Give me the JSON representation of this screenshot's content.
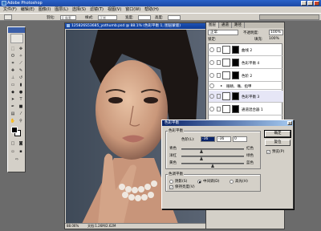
{
  "app": {
    "title": "Adobe Photoshop"
  },
  "menu": [
    "文件(F)",
    "编辑(E)",
    "图像(I)",
    "图层(L)",
    "选择(S)",
    "滤镜(T)",
    "视图(V)",
    "窗口(W)",
    "帮助(H)"
  ],
  "options": {
    "feather_label": "羽化:",
    "feather_value": "0 像素",
    "style_label": "样式:",
    "style_value": "正常",
    "width_label": "宽度:",
    "height_label": "高度:"
  },
  "document": {
    "title": "125826S53685_yothumb.psd @ 88.1% (色彩平衡 1, 图层蒙版)",
    "zoom": "88.06%",
    "status": "文档:1.26M/2.62M"
  },
  "layers_panel": {
    "tabs": [
      "图层",
      "通道",
      "路径"
    ],
    "blend_mode": "正常",
    "opacity_label": "不透明度:",
    "opacity_value": "100%",
    "lock_label": "锁定:",
    "fill_label": "填充:",
    "fill_value": "100%",
    "layers": [
      {
        "name": "曲线 2",
        "type": "adjust"
      },
      {
        "name": "色彩平衡 4",
        "type": "adjust"
      },
      {
        "name": "色阶 2",
        "type": "adjust"
      },
      {
        "name": "眼睛、嘴、指甲",
        "type": "group"
      },
      {
        "name": "色彩平衡 3",
        "type": "adjust"
      },
      {
        "name": "通道混合器 1",
        "type": "adjust"
      }
    ]
  },
  "dialog": {
    "title": "色彩平衡",
    "close": "×",
    "section_balance": "色彩平衡",
    "levels_label": "色阶(L):",
    "levels": [
      "-36",
      "-36",
      "0"
    ],
    "sliders": [
      {
        "left": "青色",
        "right": "红色",
        "value": -36
      },
      {
        "left": "洋红",
        "right": "绿色",
        "value": -36
      },
      {
        "left": "黄色",
        "right": "蓝色",
        "value": 0
      }
    ],
    "section_tone": "色调平衡",
    "tone_options": [
      "阴影(S)",
      "中间调(D)",
      "高光(H)"
    ],
    "tone_selected": 1,
    "preserve_label": "保持亮度(V)",
    "ok": "确定",
    "reset": "复位",
    "preview_label": "预览(P)"
  }
}
